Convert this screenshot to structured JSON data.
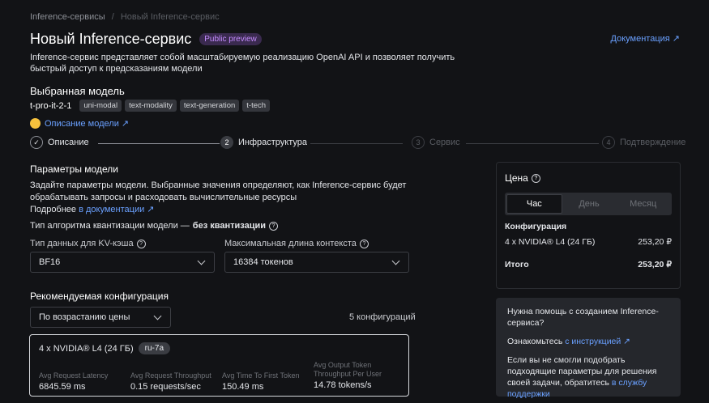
{
  "breadcrumb": {
    "root": "Inference-сервисы",
    "sep": "/",
    "current": "Новый Inference-сервис"
  },
  "page": {
    "title": "Новый Inference-сервис",
    "badge": "Public preview",
    "doc_link": "Документация ↗",
    "intro": "Inference-сервис представляет собой масштабируемую реализацию OpenAI API и позволяет получить быстрый доступ к предсказаниям модели"
  },
  "model": {
    "heading": "Выбранная модель",
    "name": "t-pro-it-2-1",
    "tags": [
      "uni-modal",
      "text-modality",
      "text-generation",
      "t-tech"
    ],
    "desc_link": "Описание модели ↗"
  },
  "stepper": {
    "steps": [
      {
        "num": "✓",
        "label": "Описание"
      },
      {
        "num": "2",
        "label": "Инфраструктура"
      },
      {
        "num": "3",
        "label": "Сервис"
      },
      {
        "num": "4",
        "label": "Подтверждение"
      }
    ]
  },
  "params": {
    "heading": "Параметры модели",
    "text": "Задайте параметры модели. Выбранные значения определяют, как Inference-сервис будет обрабатывать запросы и расходовать вычислительные ресурсы",
    "more": "Подробнее",
    "more_link": "в документации ↗",
    "quant_label": "Тип алгоритма квантизации модели —",
    "quant_value": "без квантизации",
    "kv_label": "Тип данных для KV-кэша",
    "kv_value": "BF16",
    "ctx_label": "Максимальная длина контекста",
    "ctx_value": "16384 токенов"
  },
  "recommended": {
    "heading": "Рекомендуемая конфигурация",
    "sort_value": "По возрастанию цены",
    "count": "5 конфигураций",
    "card": {
      "gpu": "4 x NVIDIA® L4 (24 ГБ)",
      "region": "ru-7a",
      "metrics": [
        {
          "label": "Avg Request Latency",
          "value": "6845.59 ms"
        },
        {
          "label": "Avg Request Throughput",
          "value": "0.15 requests/sec"
        },
        {
          "label": "Avg Time To First Token",
          "value": "150.49 ms"
        },
        {
          "label": "Avg Output Token Throughput Per User",
          "value": "14.78 tokens/s"
        }
      ]
    }
  },
  "price": {
    "heading": "Цена",
    "tabs": [
      "Час",
      "День",
      "Месяц"
    ],
    "active_tab": "Час",
    "config_label": "Конфигурация",
    "config_item": "4 x NVIDIA® L4 (24 ГБ)",
    "config_price": "253,20 ₽",
    "total_label": "Итого",
    "total_price": "253,20 ₽"
  },
  "help": {
    "title": "Нужна помощь с созданием Inference-сервиса?",
    "read": "Ознакомьтесь",
    "read_link": "с инструкцией ↗",
    "fail": "Если вы не смогли подобрать подходящие параметры для решения своей задачи, обратитесь",
    "support_link": "в службу поддержки"
  }
}
